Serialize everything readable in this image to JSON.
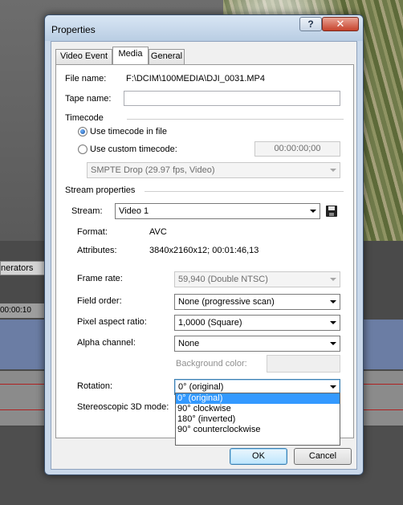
{
  "background": {
    "generators_tab": "nerators",
    "timecode": "00:00:10"
  },
  "dialog": {
    "title": "Properties",
    "help_glyph": "?",
    "close_glyph": "✕",
    "tabs": [
      {
        "label": "Video Event",
        "active": false
      },
      {
        "label": "Media",
        "active": true
      },
      {
        "label": "General",
        "active": false
      }
    ],
    "file_name_label": "File name:",
    "file_name_value": "F:\\DCIM\\100MEDIA\\DJI_0031.MP4",
    "tape_name_label": "Tape name:",
    "tape_name_value": "",
    "timecode_section": "Timecode",
    "use_timecode_in_file": "Use timecode in file",
    "use_custom_timecode": "Use custom timecode:",
    "custom_timecode_value": "00:00:00;00",
    "timecode_format": "SMPTE Drop (29.97 fps, Video)",
    "stream_section": "Stream properties",
    "stream_label": "Stream:",
    "stream_value": "Video 1",
    "format_label": "Format:",
    "format_value": "AVC",
    "attributes_label": "Attributes:",
    "attributes_value": "3840x2160x12; 00:01:46,13",
    "frame_rate_label": "Frame rate:",
    "frame_rate_value": "59,940 (Double NTSC)",
    "field_order_label": "Field order:",
    "field_order_value": "None (progressive scan)",
    "pixel_aspect_label": "Pixel aspect ratio:",
    "pixel_aspect_value": "1,0000 (Square)",
    "alpha_label": "Alpha channel:",
    "alpha_value": "None",
    "bg_color_label": "Background color:",
    "rotation_label": "Rotation:",
    "rotation_value": "0° (original)",
    "stereo_label": "Stereoscopic 3D mode:",
    "rotation_options": [
      "0° (original)",
      "90° clockwise",
      "180° (inverted)",
      "90° counterclockwise"
    ],
    "ok_label": "OK",
    "cancel_label": "Cancel"
  }
}
